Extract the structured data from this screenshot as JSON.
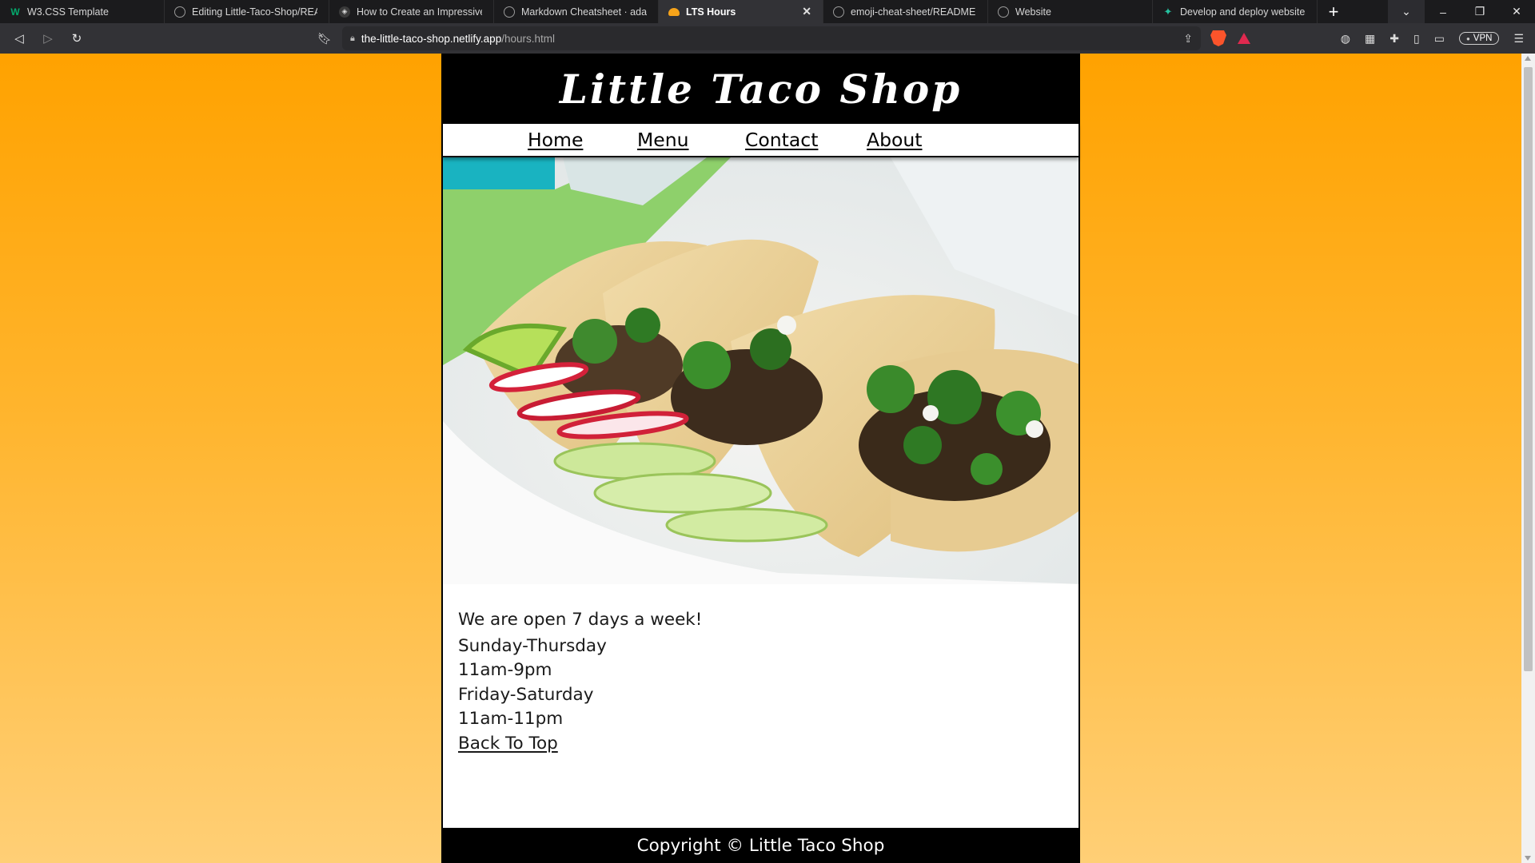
{
  "browser": {
    "tabs": [
      {
        "title": "W3.CSS Template",
        "icon": "w3schools-icon"
      },
      {
        "title": "Editing Little-Taco-Shop/READM",
        "icon": "github-icon"
      },
      {
        "title": "How to Create an Impressive Gi",
        "icon": "hashnode-icon"
      },
      {
        "title": "Markdown Cheatsheet · adam-p",
        "icon": "github-icon"
      },
      {
        "title": "LTS Hours",
        "icon": "taco-icon",
        "active": true
      },
      {
        "title": "emoji-cheat-sheet/README.md",
        "icon": "github-icon"
      },
      {
        "title": "Website",
        "icon": "globe-icon"
      },
      {
        "title": "Develop and deploy websites a",
        "icon": "netlify-icon"
      }
    ],
    "new_tab_glyph": "+",
    "window_controls": {
      "dropdown": "⌄",
      "minimize": "–",
      "restore": "❐",
      "close": "✕"
    },
    "address": {
      "host": "the-little-taco-shop.netlify.app",
      "path": "/hours.html"
    },
    "vpn_label": "VPN"
  },
  "page": {
    "site_title": "Little Taco Shop",
    "nav": [
      {
        "label": "Home"
      },
      {
        "label": "Menu"
      },
      {
        "label": "Contact"
      },
      {
        "label": "About"
      }
    ],
    "hero_alt": "Tacos with cilantro, lime and radish",
    "intro": "We are open 7 days a week!",
    "hours": [
      {
        "days": "Sunday-Thursday",
        "time": "11am-9pm"
      },
      {
        "days": "Friday-Saturday",
        "time": "11am-11pm"
      }
    ],
    "back_to_top": "Back To Top",
    "footer": "Copyright © Little Taco Shop"
  },
  "colors": {
    "gradient_top": "#ffa200",
    "gradient_bottom": "#ffcf76",
    "header_bg": "#000000",
    "content_bg": "#ffffff"
  }
}
